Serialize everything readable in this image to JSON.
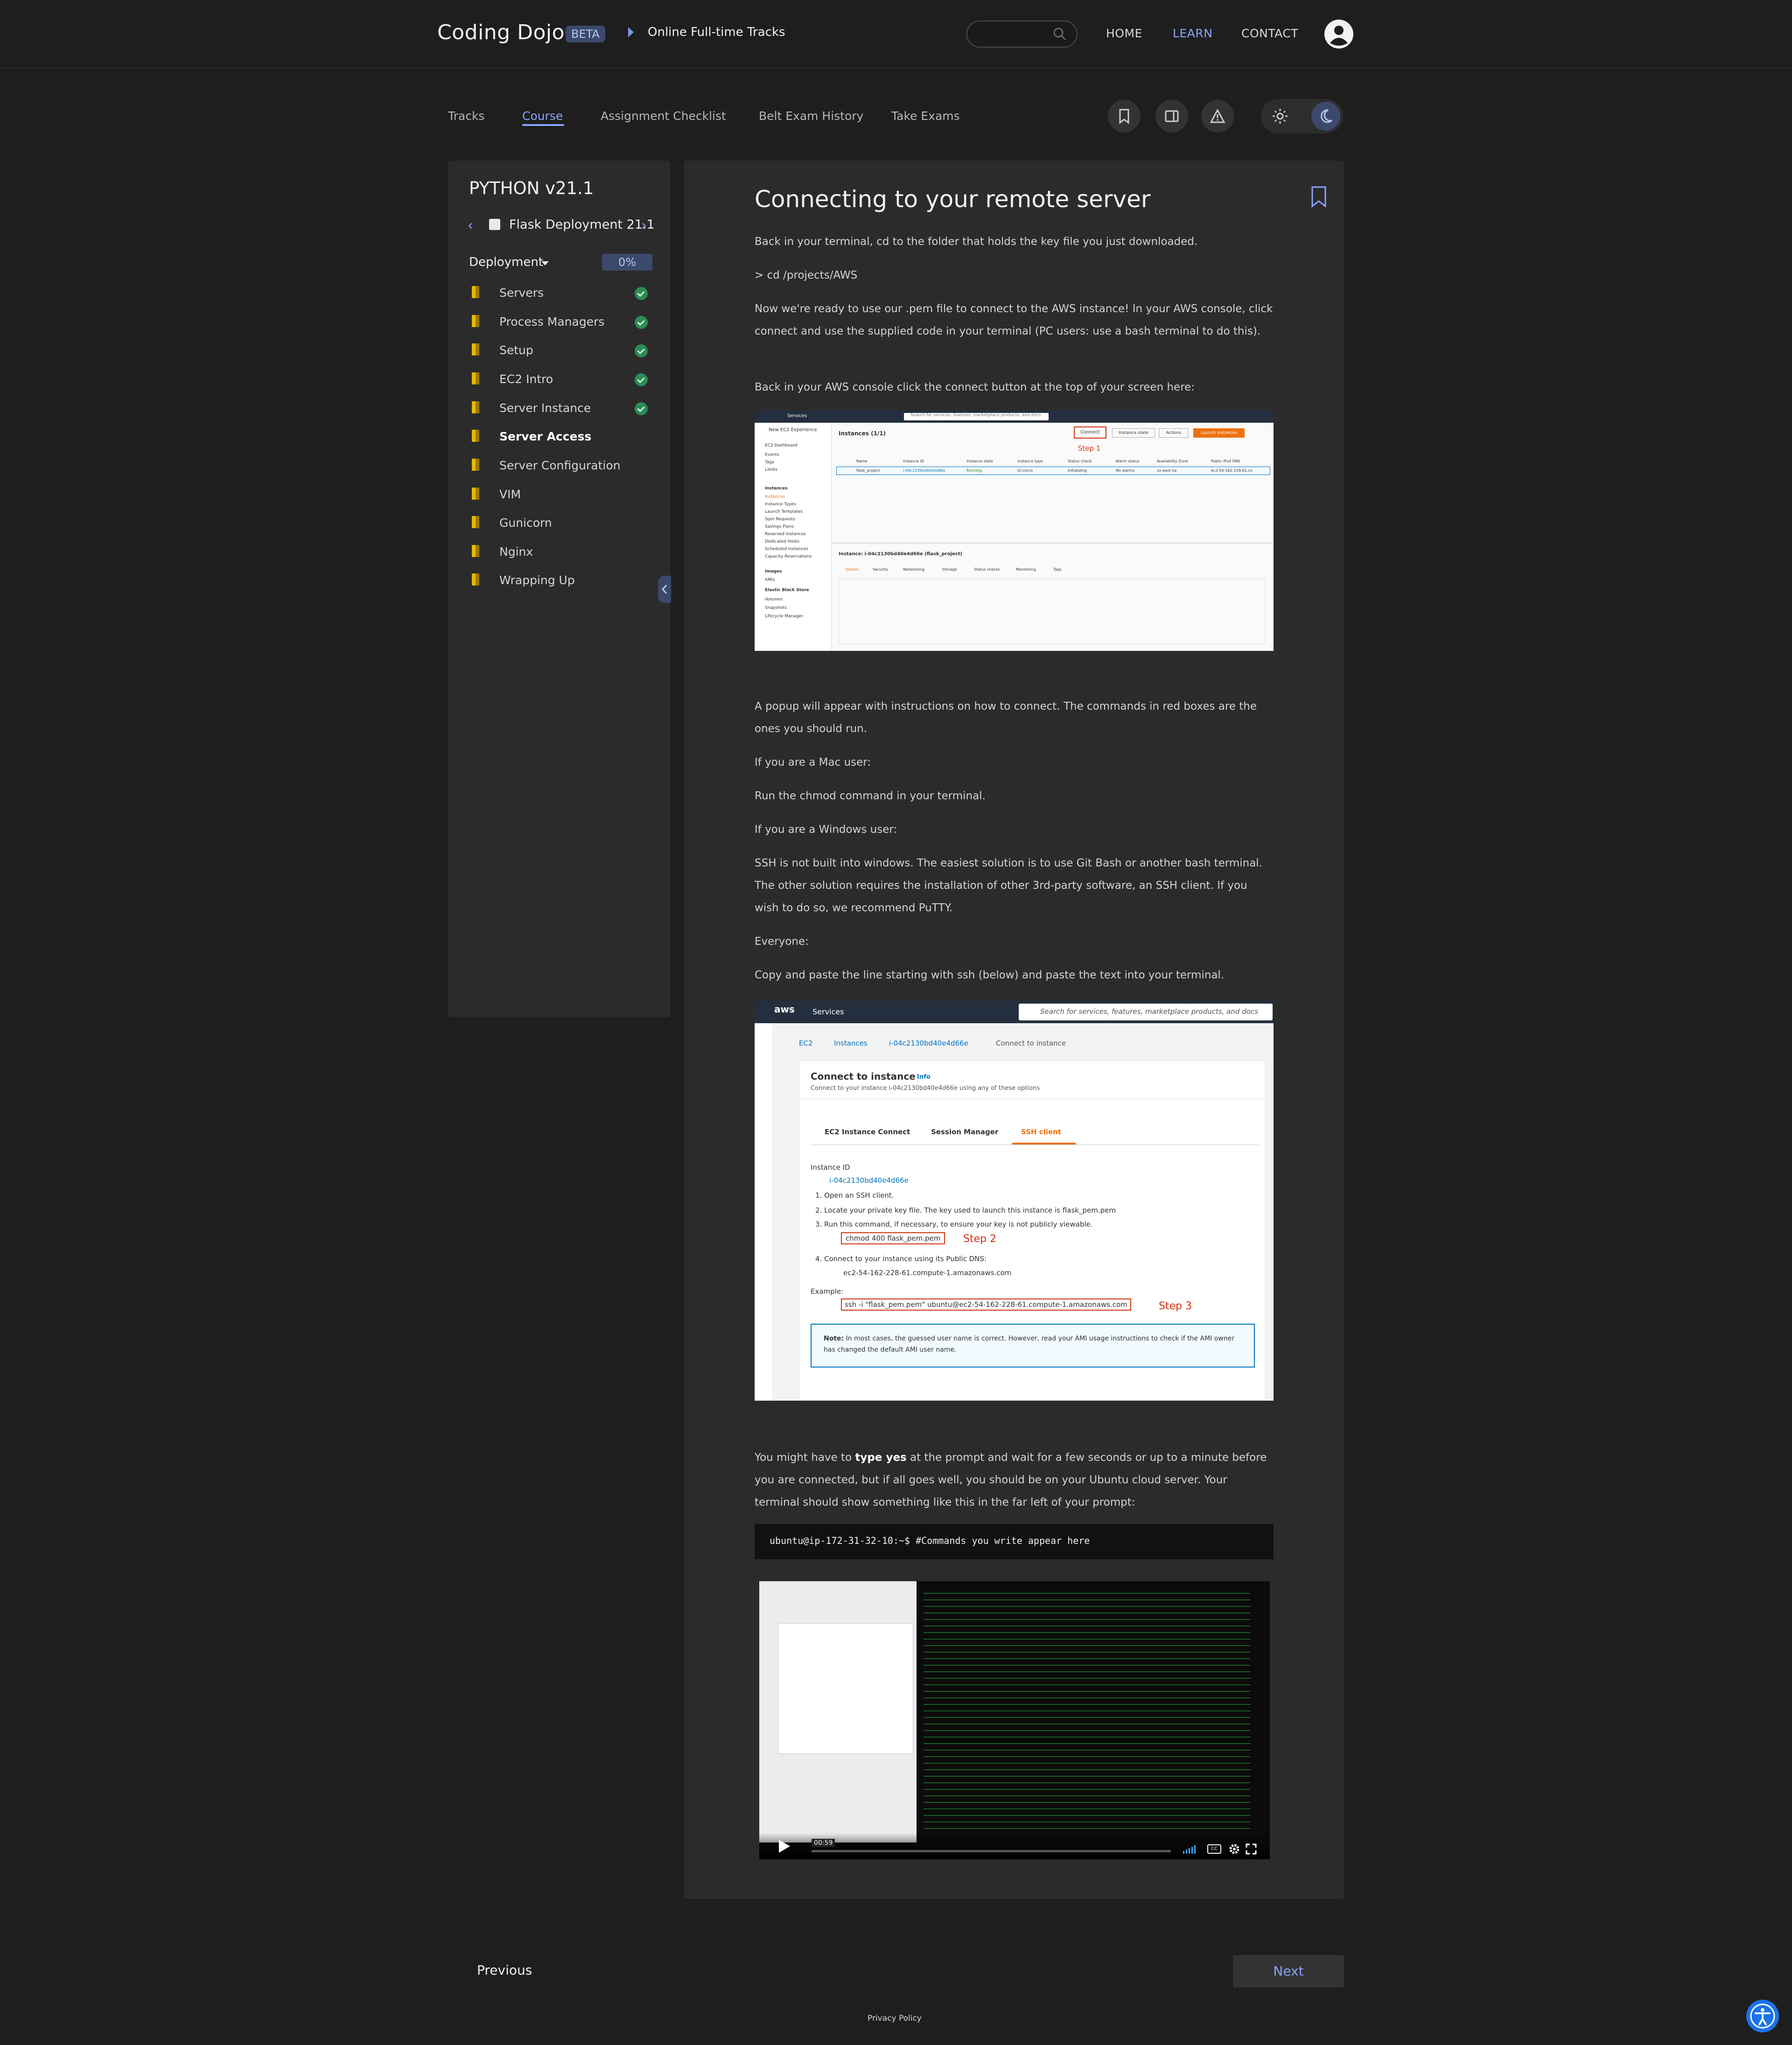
{
  "header": {
    "logo": "Coding Dojo",
    "beta": "BETA",
    "breadcrumb": "Online Full-time Tracks",
    "nav": {
      "home": "HOME",
      "learn": "LEARN",
      "contact": "CONTACT"
    }
  },
  "subnav": {
    "tabs": [
      "Tracks",
      "Course",
      "Assignment Checklist",
      "Belt Exam History",
      "Take Exams"
    ],
    "active_tab": "Course"
  },
  "sidebar": {
    "course": "PYTHON v21.1",
    "module": "Flask Deployment 21.1",
    "chapter": "Deployment",
    "progress": "0%",
    "items": [
      {
        "label": "Servers",
        "done": true
      },
      {
        "label": "Process Managers",
        "done": true
      },
      {
        "label": "Setup",
        "done": true
      },
      {
        "label": "EC2 Intro",
        "done": true
      },
      {
        "label": "Server Instance",
        "done": true
      },
      {
        "label": "Server Access",
        "done": false
      },
      {
        "label": "Server Configuration",
        "done": false
      },
      {
        "label": "VIM",
        "done": false
      },
      {
        "label": "Gunicorn",
        "done": false
      },
      {
        "label": "Nginx",
        "done": false
      },
      {
        "label": "Wrapping Up",
        "done": false
      }
    ],
    "active_item": "Server Access"
  },
  "lesson": {
    "title": "Connecting to your remote server",
    "p1": "Back in your terminal, cd to the folder that holds the key file you just downloaded.",
    "p2": "> cd /projects/AWS",
    "p3": "Now we're ready to use our .pem file to connect to the AWS instance! In your AWS console, click connect and use the supplied code in your terminal (PC users: use a bash terminal to do this).",
    "p4": "Back in your AWS console click the connect button at the top of your screen here:",
    "p5": "A popup will appear with instructions on how to connect. The commands in red boxes are the ones you should run.",
    "p6": "If you are a Mac user:",
    "p7": "Run the chmod command in your terminal.",
    "p8": "If you are a Windows user:",
    "p9": "SSH is not built into windows. The easiest solution is to use Git Bash or another bash terminal. The other solution requires the installation of other 3rd-party software, an SSH client. If you wish to do so, we recommend PuTTY.",
    "p10": "Everyone:",
    "p11": "Copy and paste the line starting with ssh (below) and paste the text into your terminal.",
    "p12_a": "You might have to ",
    "p12_b": "type yes",
    "p12_c": " at the prompt and wait for a few seconds or up to a minute before you are connected, but if all goes well, you should be on your Ubuntu cloud server. Your terminal should show something like this in the far left of your prompt:",
    "terminal": "ubuntu@ip-172-31-32-10:~$ #Commands you write appear here",
    "video_time": "00:59"
  },
  "screenshot1": {
    "services": "Services",
    "search": "Search for services, features, marketplace products, and docs",
    "instances": "Instances (1/1)",
    "connect": "Connect",
    "instance_state": "Instance state",
    "actions": "Actions",
    "launch": "Launch instances",
    "step": "Step 1",
    "cols": [
      "Name",
      "Instance ID",
      "Instance state",
      "Instance type",
      "Status check",
      "Alarm status",
      "Availability Zone",
      "Public IPv4 DNS"
    ],
    "row": [
      "flask_project",
      "i-04c2130bd40e4d66e",
      "Running",
      "t2.micro",
      "Initializing",
      "No alarms",
      "us-east-1a",
      "ec2-54-162-228-61.co"
    ],
    "detail_title": "Instance: i-04c2130bd40e4d66e (flask_project)",
    "detail_tabs": [
      "Details",
      "Security",
      "Networking",
      "Storage",
      "Status checks",
      "Monitoring",
      "Tags"
    ],
    "sidebar_items": [
      "New EC2 Experience",
      "EC2 Dashboard",
      "Events",
      "Tags",
      "Limits",
      "Instances",
      "Instances",
      "Instance Types",
      "Launch Templates",
      "Spot Requests",
      "Savings Plans",
      "Reserved Instances",
      "Dedicated Hosts",
      "Scheduled Instances",
      "Capacity Reservations",
      "Images",
      "AMIs",
      "Elastic Block Store",
      "Volumes",
      "Snapshots",
      "Lifecycle Manager"
    ]
  },
  "screenshot2": {
    "aws": "aws",
    "services": "Services",
    "search": "Search for services, features, marketplace products, and docs",
    "crumbs": [
      "EC2",
      "Instances",
      "i-04c2130bd40e4d66e",
      "Connect to instance"
    ],
    "title": "Connect to instance",
    "info": "Info",
    "subtitle": "Connect to your instance i-04c2130bd40e4d66e using any of these options",
    "tabs": [
      "EC2 Instance Connect",
      "Session Manager",
      "SSH client"
    ],
    "instance_id_label": "Instance ID",
    "instance_id": "i-04c2130bd40e4d66e",
    "step1": "1. Open an SSH client.",
    "step2": "2. Locate your private key file. The key used to launch this instance is flask_pem.pem",
    "step3": "3. Run this command, if necessary, to ensure your key is not publicly viewable.",
    "chmod": "chmod 400 flask_pem.pem",
    "step2_label": "Step 2",
    "step4": "4. Connect to your instance using its Public DNS:",
    "dns": "ec2-54-162-228-61.compute-1.amazonaws.com",
    "example": "Example:",
    "ssh": "ssh -i \"flask_pem.pem\" ubuntu@ec2-54-162-228-61.compute-1.amazonaws.com",
    "step3_label": "Step 3",
    "note_b": "Note:",
    "note": "In most cases, the guessed user name is correct. However, read your AMI usage instructions to check if the AMI owner has changed the default AMI user name."
  },
  "footer": {
    "previous": "Previous",
    "next": "Next",
    "privacy": "Privacy Policy"
  }
}
